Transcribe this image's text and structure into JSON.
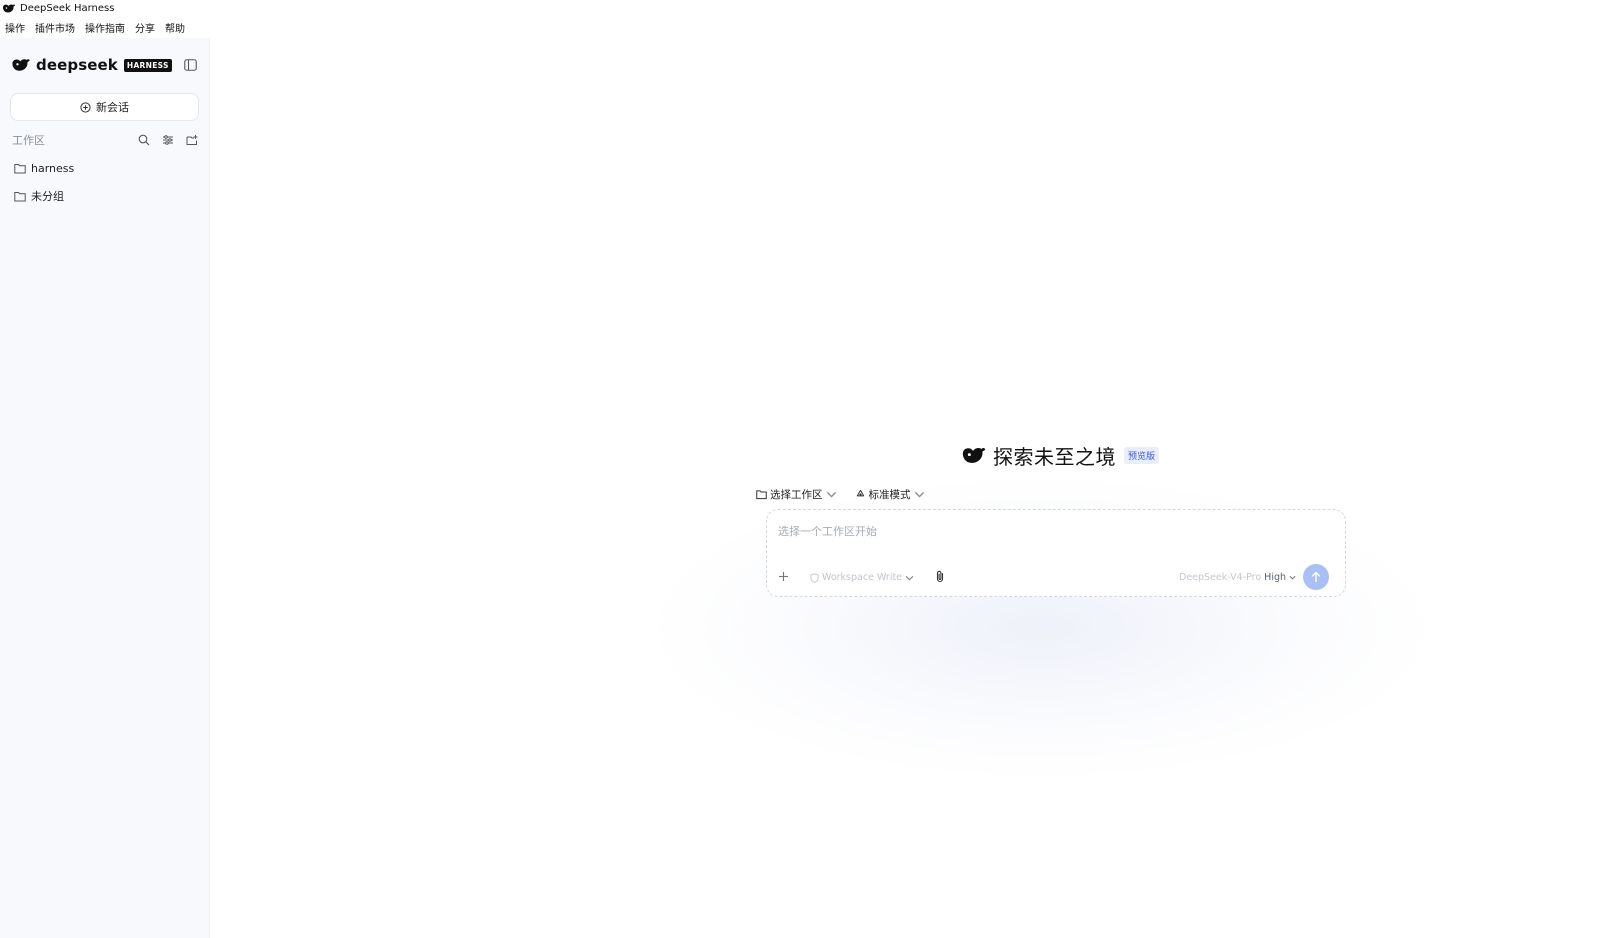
{
  "window": {
    "title": "DeepSeek Harness"
  },
  "menu": [
    "操作",
    "插件市场",
    "操作指南",
    "分享",
    "帮助"
  ],
  "sidebar": {
    "brand_name": "deepseek",
    "brand_badge": "HARNESS",
    "new_chat_label": "新会话",
    "workspace_title": "工作区",
    "folders": [
      {
        "label": "harness"
      },
      {
        "label": "未分组"
      }
    ]
  },
  "main": {
    "hero_title": "探索未至之境",
    "hero_badge": "预览版",
    "options": {
      "workspace_label": "选择工作区",
      "mode_label": "标准模式"
    },
    "composer": {
      "placeholder": "选择一个工作区开始",
      "permission_label": "Workspace Write",
      "model_name": "DeepSeek-V4-Pro",
      "model_level": "High"
    }
  },
  "colors": {
    "accent": "#a8c0f4",
    "badge_text": "#3b5bd9",
    "badge_bg": "#e8eefc",
    "sidebar_bg": "#f8f9fc"
  }
}
